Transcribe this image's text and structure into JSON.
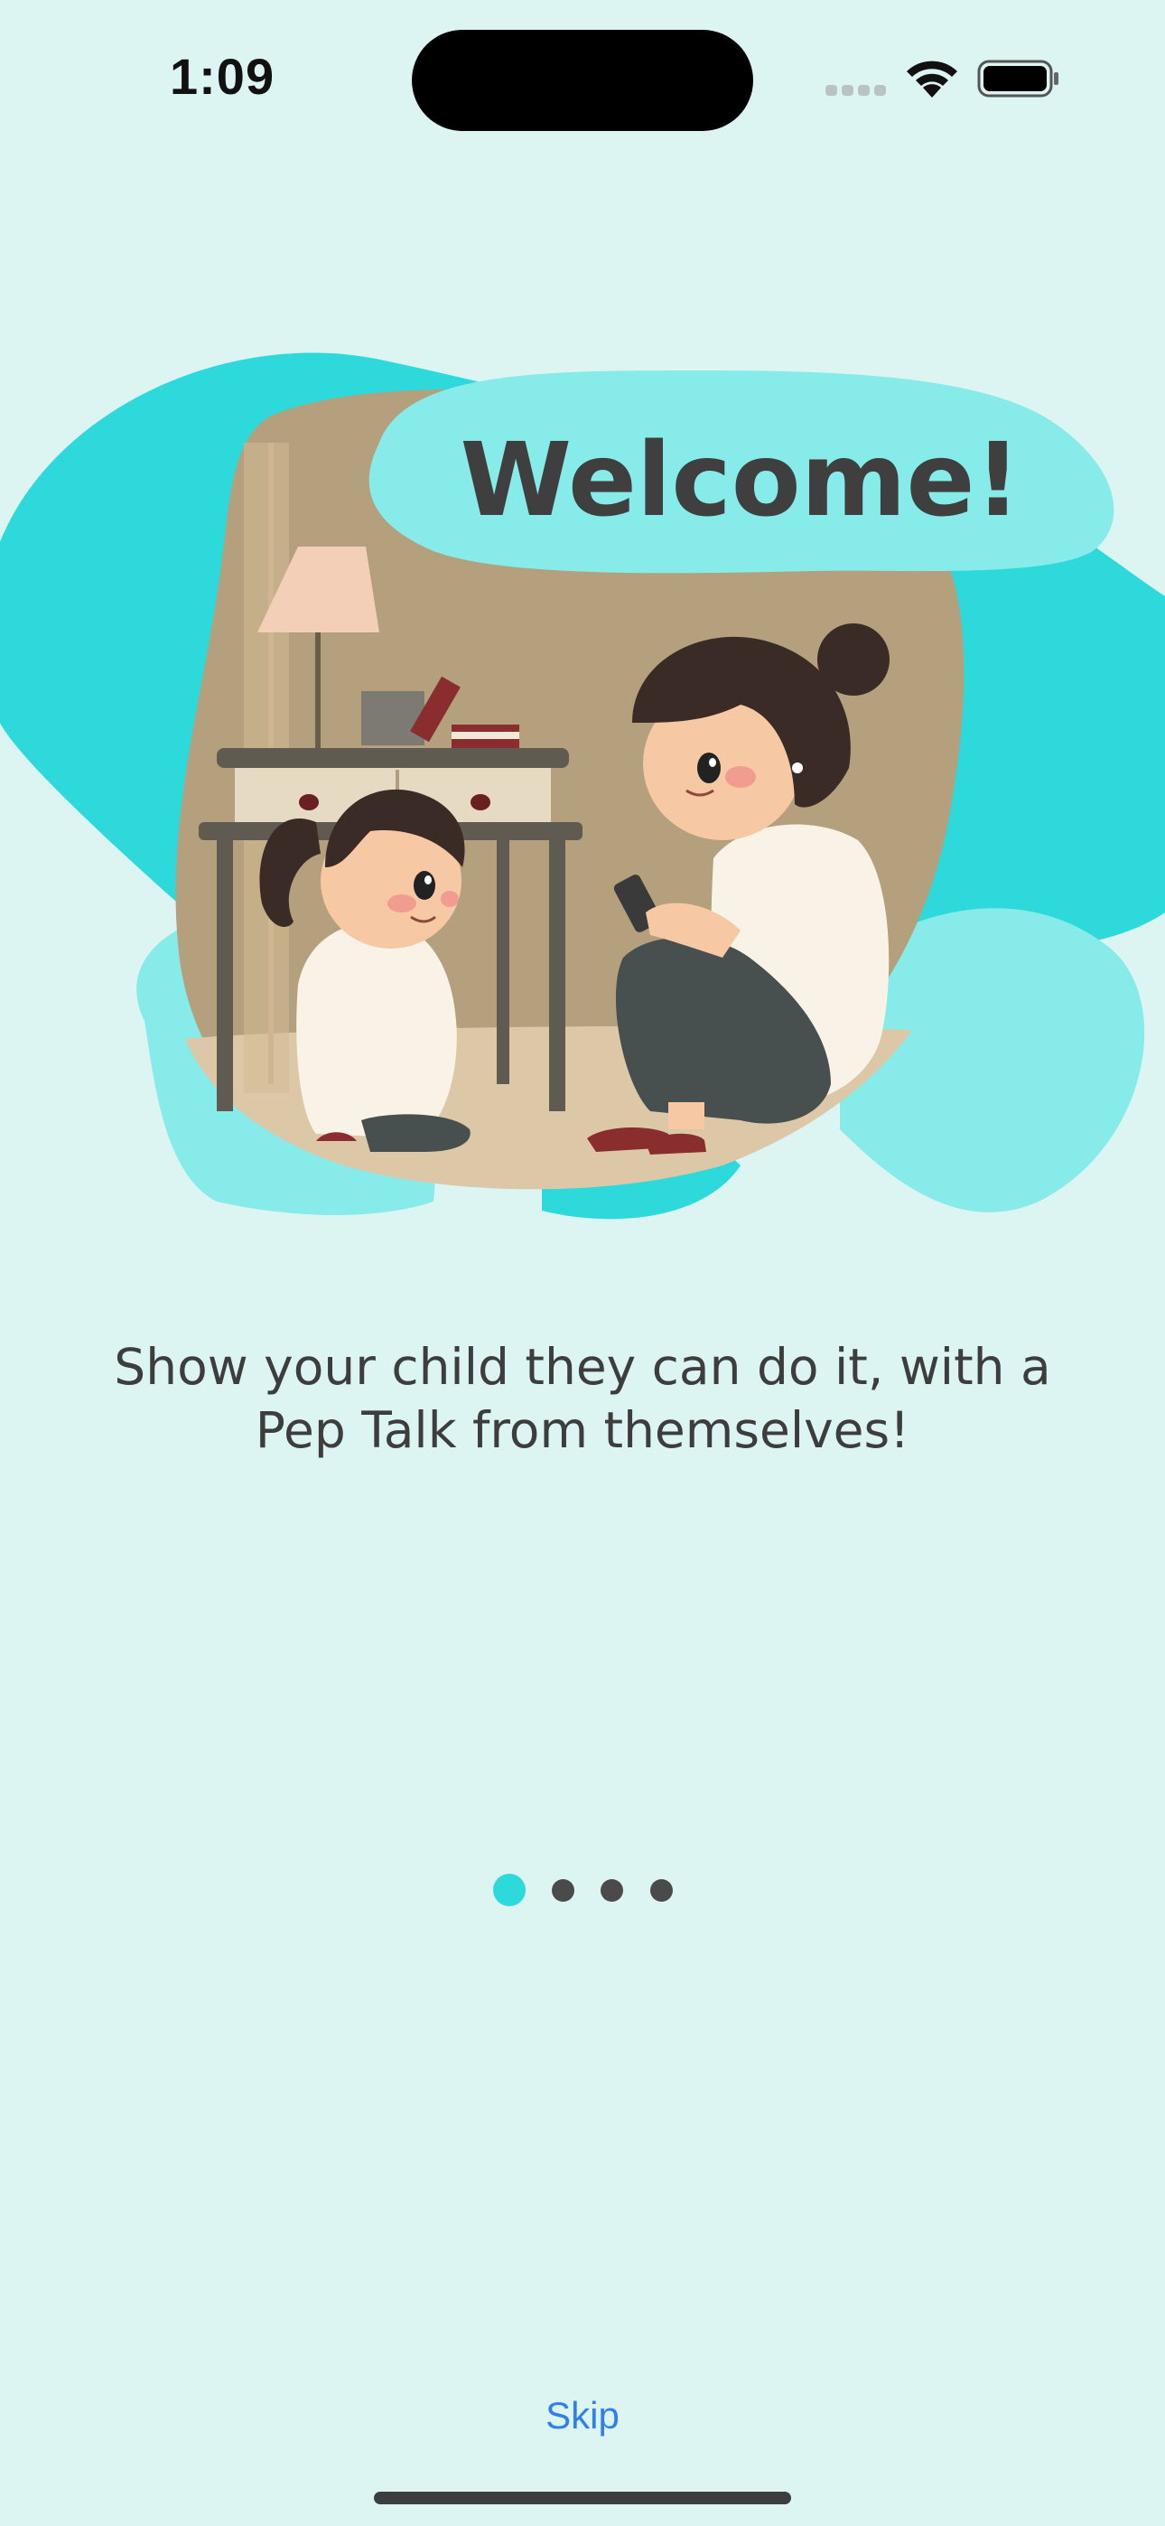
{
  "status_bar": {
    "time": "1:09",
    "icons": [
      "cellular-signal-icon",
      "wifi-icon",
      "battery-icon"
    ]
  },
  "hero": {
    "welcome_text": "Welcome!",
    "illustration": "mother-and-child-illustration"
  },
  "onboarding": {
    "caption_line1": "Show your child they can do it, with a",
    "caption_line2": "Pep Talk from themselves!",
    "page_indicator": {
      "total_pages": 4,
      "current_page": 1
    },
    "skip_label": "Skip"
  },
  "colors": {
    "background": "#dcf5f2",
    "accent": "#2ed9dc",
    "accent_light": "#86ebe9",
    "link": "#2f80ed",
    "text": "#3d3d3d"
  }
}
